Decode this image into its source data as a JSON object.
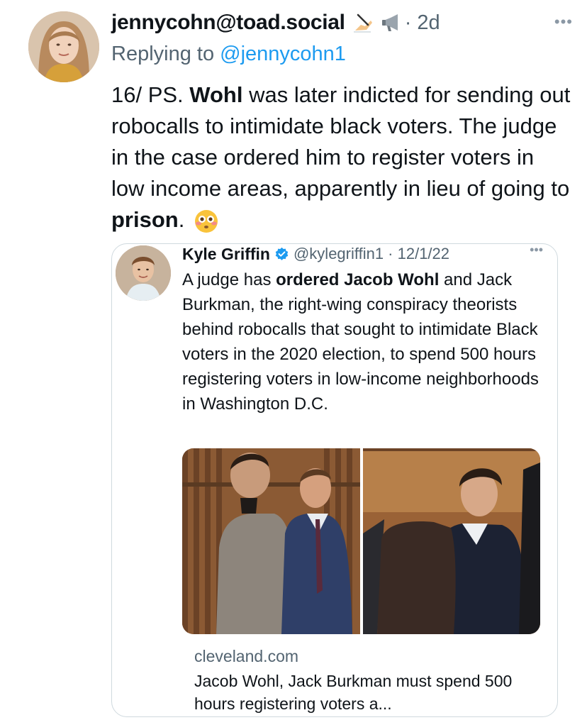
{
  "tweet": {
    "author_handle": "jennycohn@toad.social",
    "time": "· 2d",
    "replying_prefix": "Replying to ",
    "replying_handle": "@jennycohn1",
    "text_parts": {
      "p1": "16/ PS. ",
      "b1": "Wohl",
      "p2": " was later indicted for sending out robocalls to intimidate black voters. The judge in the case ordered him to register voters in low income areas, apparently in lieu of going to ",
      "b2": "prison",
      "p3": ". "
    },
    "more_glyph": "•••"
  },
  "quote": {
    "name": "Kyle Griffin",
    "meta": "@kylegriffin1 · 12/1/22",
    "more_glyph": "•••",
    "text_parts": {
      "p1": "A judge has ",
      "b1": "ordered Jacob Wohl",
      "p2": " and Jack Burkman, the right-wing conspiracy theorists behind robocalls that sought to intimidate Black voters in the 2020 election, to spend 500 hours registering voters in low-income neighborhoods in Washington D.C."
    },
    "card": {
      "domain": "cleveland.com",
      "title": "Jacob Wohl, Jack Burkman must spend 500 hours registering voters a..."
    }
  },
  "icons": {
    "writing_hand": "writing-hand-icon",
    "megaphone": "megaphone-icon",
    "flushed_face": "flushed-face-emoji",
    "verified": "verified-badge-icon"
  },
  "colors": {
    "link": "#1d9bf0",
    "secondary_text": "#536471",
    "border": "#cfd9de"
  }
}
